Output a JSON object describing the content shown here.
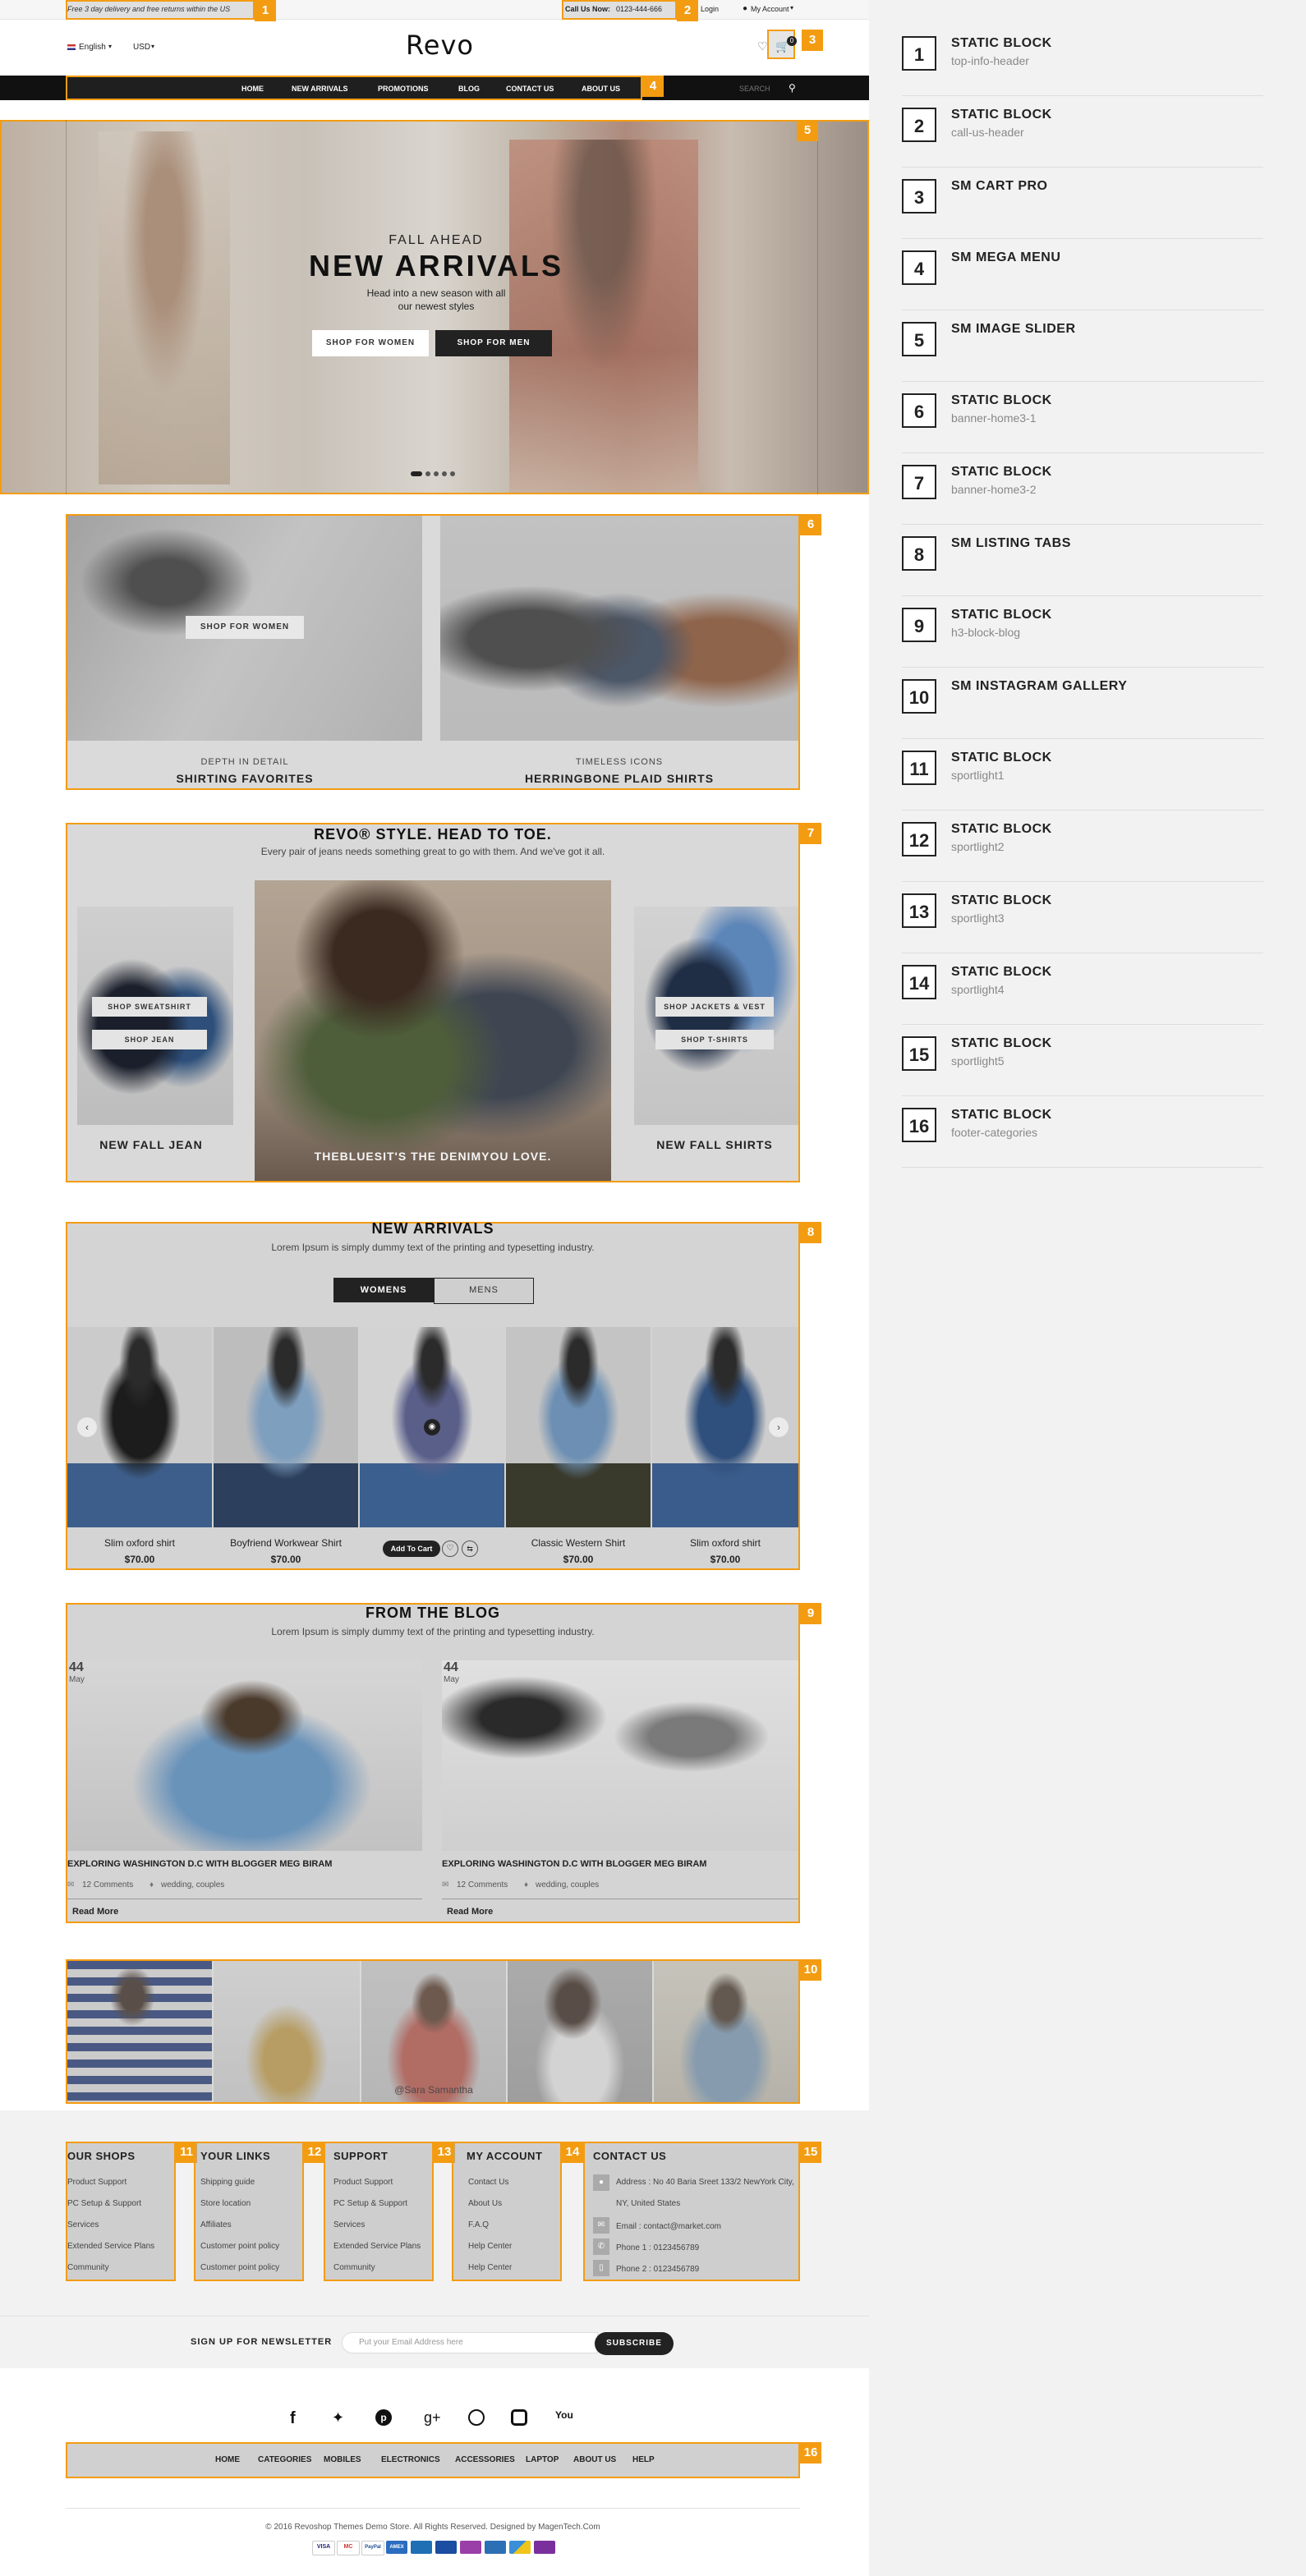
{
  "legend": [
    {
      "num": "1",
      "title": "STATIC BLOCK",
      "sub": "top-info-header"
    },
    {
      "num": "2",
      "title": "STATIC BLOCK",
      "sub": "call-us-header"
    },
    {
      "num": "3",
      "title": "SM CART PRO",
      "sub": ""
    },
    {
      "num": "4",
      "title": "SM MEGA MENU",
      "sub": ""
    },
    {
      "num": "5",
      "title": "SM IMAGE SLIDER",
      "sub": ""
    },
    {
      "num": "6",
      "title": "STATIC BLOCK",
      "sub": "banner-home3-1"
    },
    {
      "num": "7",
      "title": "STATIC BLOCK",
      "sub": "banner-home3-2"
    },
    {
      "num": "8",
      "title": "SM LISTING TABS",
      "sub": ""
    },
    {
      "num": "9",
      "title": "STATIC BLOCK",
      "sub": "h3-block-blog"
    },
    {
      "num": "10",
      "title": "SM INSTAGRAM GALLERY",
      "sub": ""
    },
    {
      "num": "11",
      "title": "STATIC BLOCK",
      "sub": "sportlight1"
    },
    {
      "num": "12",
      "title": "STATIC BLOCK",
      "sub": "sportlight2"
    },
    {
      "num": "13",
      "title": "STATIC BLOCK",
      "sub": "sportlight3"
    },
    {
      "num": "14",
      "title": "STATIC BLOCK",
      "sub": "sportlight4"
    },
    {
      "num": "15",
      "title": "STATIC BLOCK",
      "sub": "sportlight5"
    },
    {
      "num": "16",
      "title": "STATIC BLOCK",
      "sub": "footer-categories"
    }
  ],
  "topbar": {
    "info": "Free 3 day delivery and free returns within the US",
    "call_label": "Call Us Now:",
    "call_number": "0123-444-666",
    "login": "Login",
    "account": "My Account"
  },
  "header": {
    "language": "English",
    "currency": "USD",
    "logo": "Revo",
    "cart_count": "0"
  },
  "menu": {
    "items": [
      "HOME",
      "NEW ARRIVALS",
      "PROMOTIONS",
      "BLOG",
      "CONTACT US",
      "ABOUT US"
    ],
    "search_placeholder": "SEARCH"
  },
  "slider": {
    "kicker": "FALL AHEAD",
    "title": "NEW ARRIVALS",
    "text1": "Head into a new season with all",
    "text2": "our newest styles",
    "btn_women": "SHOP FOR WOMEN",
    "btn_men": "SHOP FOR MEN"
  },
  "banner1": {
    "btn": "SHOP FOR WOMEN",
    "left_kicker": "DEPTH IN DETAIL",
    "left_title": "SHIRTING FAVORITES",
    "right_kicker": "TIMELESS ICONS",
    "right_title": "HERRINGBONE PLAID SHIRTS"
  },
  "banner2": {
    "title": "REVO® STYLE. HEAD TO TOE.",
    "sub": "Every pair of jeans needs something great to go with them. And we've got it all.",
    "btn_sweatshirt": "SHOP SWEATSHIRT",
    "btn_jean": "SHOP JEAN",
    "left_caption": "NEW FALL JEAN",
    "center_caption": "THEBLUESIT'S THE DENIMYOU LOVE.",
    "btn_jackets": "SHOP JACKETS & VEST",
    "btn_tshirts": "SHOP T-SHIRTS",
    "right_caption": "NEW FALL SHIRTS"
  },
  "listing": {
    "title": "NEW ARRIVALS",
    "sub": "Lorem Ipsum is simply dummy text of the printing and typesetting industry.",
    "tab_women": "WOMENS",
    "tab_men": "MENS",
    "add_to_cart": "Add To Cart",
    "products": [
      {
        "name": "Slim oxford shirt",
        "price": "$70.00"
      },
      {
        "name": "Boyfriend Workwear Shirt",
        "price": "$70.00"
      },
      {
        "name": "",
        "price": ""
      },
      {
        "name": "Classic Western Shirt",
        "price": "$70.00"
      },
      {
        "name": "Slim oxford shirt",
        "price": "$70.00"
      }
    ]
  },
  "blog": {
    "title": "FROM THE BLOG",
    "sub": "Lorem Ipsum is simply dummy text of the printing and typesetting industry.",
    "posts": [
      {
        "day": "44",
        "month": "May",
        "title": "EXPLORING WASHINGTON D.C WITH BLOGGER MEG BIRAM",
        "comments": "12 Comments",
        "tags": "wedding, couples",
        "more": "Read More"
      },
      {
        "day": "44",
        "month": "May",
        "title": "EXPLORING WASHINGTON D.C WITH BLOGGER MEG BIRAM",
        "comments": "12 Comments",
        "tags": "wedding, couples",
        "more": "Read More"
      }
    ]
  },
  "instagram": {
    "caption": "@Sara Samantha"
  },
  "footer": {
    "shops": {
      "title": "OUR SHOPS",
      "links": [
        "Product Support",
        "PC Setup & Support",
        "Services",
        "Extended Service Plans",
        "Community"
      ]
    },
    "links": {
      "title": "YOUR LINKS",
      "links": [
        "Shipping guide",
        "Store location",
        "Affiliates",
        "Customer point policy",
        "Customer point policy"
      ]
    },
    "support": {
      "title": "SUPPORT",
      "links": [
        "Product Support",
        "PC Setup & Support",
        "Services",
        "Extended Service Plans",
        "Community"
      ]
    },
    "account": {
      "title": "MY ACCOUNT",
      "links": [
        "Contact Us",
        "About Us",
        "F.A.Q",
        "Help Center",
        "Help Center"
      ]
    },
    "contact": {
      "title": "CONTACT US",
      "address1": "Address : No 40 Baria Sreet 133/2 NewYork City,",
      "address2": "NY, United States",
      "email": "Email : contact@market.com",
      "phone1": "Phone 1 : 0123456789",
      "phone2": "Phone 2 : 0123456789"
    },
    "newsletter_label": "SIGN UP FOR NEWSLETTER",
    "newsletter_placeholder": "Put your Email Address here",
    "subscribe": "SUBSCRIBE",
    "categories": [
      "HOME",
      "CATEGORIES",
      "MOBILES",
      "ELECTRONICS",
      "ACCESSORIES",
      "LAPTOP",
      "ABOUT US",
      "HELP"
    ],
    "copyright": "© 2016 Revoshop Themes Demo Store. All Rights Reserved. Designed by MagenTech.Com",
    "payments": [
      "VISA",
      "MC",
      "PayPal",
      "AMEX",
      "",
      "",
      "",
      "",
      ""
    ]
  },
  "colors": {
    "accent": "#f39c12",
    "dark": "#111111"
  }
}
